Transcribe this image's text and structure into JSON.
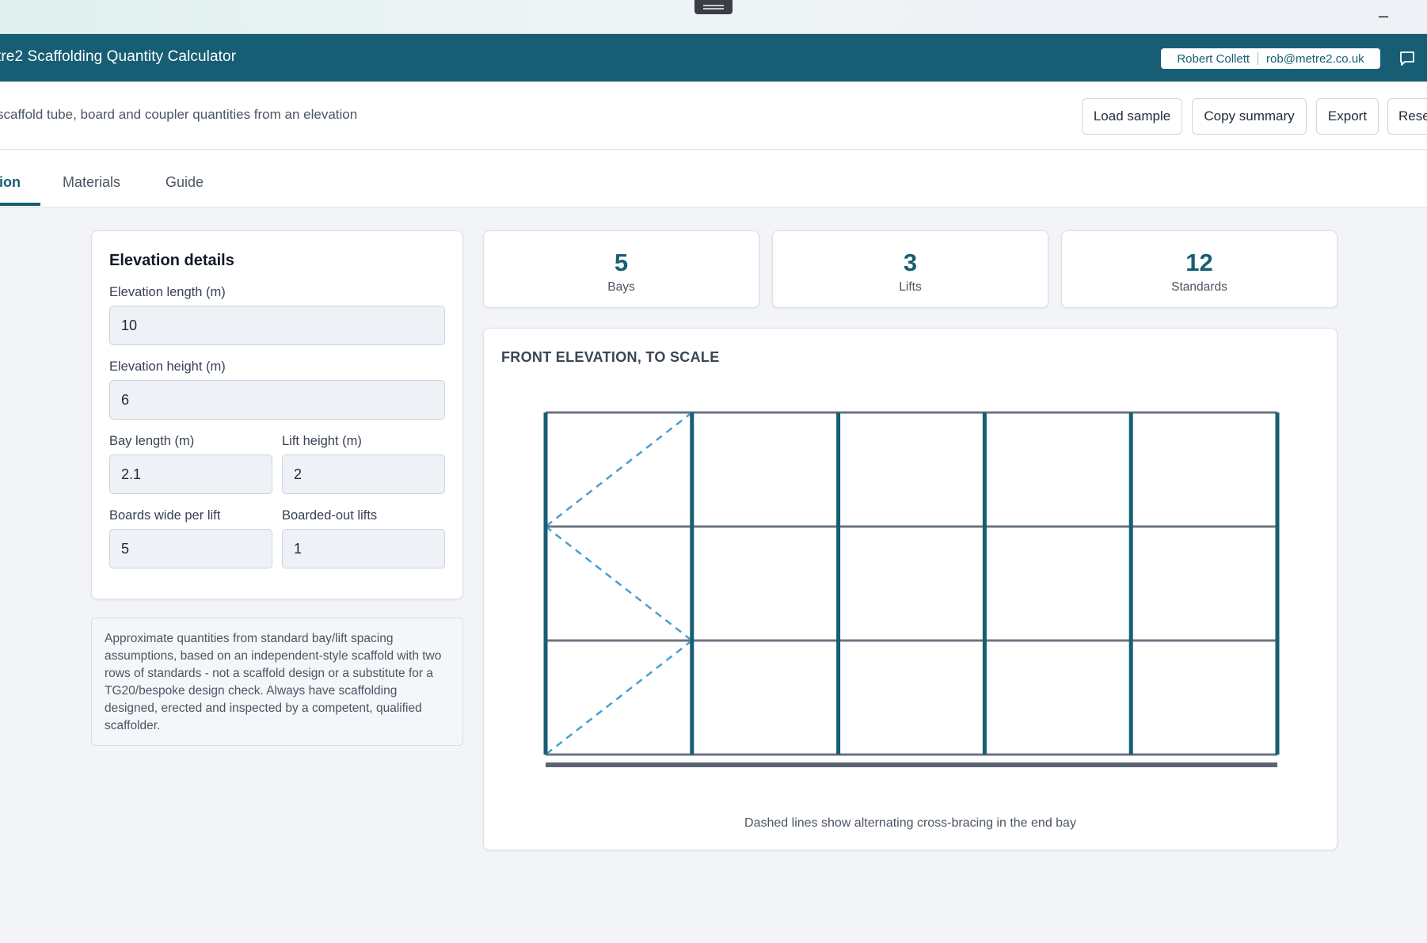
{
  "window": {
    "minimize_glyph": "–"
  },
  "header": {
    "title": "tre2 Scaffolding Quantity Calculator",
    "user_name": "Robert Collett",
    "user_email": "rob@metre2.co.uk"
  },
  "subheader": {
    "subtitle": "scaffold tube, board and coupler quantities from an elevation",
    "buttons": {
      "load_sample": "Load sample",
      "copy_summary": "Copy summary",
      "export": "Export",
      "reset": "Rese"
    }
  },
  "tabs": [
    {
      "label": "ion",
      "active": true
    },
    {
      "label": "Materials",
      "active": false
    },
    {
      "label": "Guide",
      "active": false
    }
  ],
  "form": {
    "title": "Elevation details",
    "elevation_length": {
      "label": "Elevation length (m)",
      "value": "10"
    },
    "elevation_height": {
      "label": "Elevation height (m)",
      "value": "6"
    },
    "bay_length": {
      "label": "Bay length (m)",
      "value": "2.1"
    },
    "lift_height": {
      "label": "Lift height (m)",
      "value": "2"
    },
    "boards_wide": {
      "label": "Boards wide per lift",
      "value": "5"
    },
    "boarded_lifts": {
      "label": "Boarded-out lifts",
      "value": "1"
    }
  },
  "note": "Approximate quantities from standard bay/lift spacing assumptions, based on an independent-style scaffold with two rows of standards - not a scaffold design or a substitute for a TG20/bespoke design check. Always have scaffolding designed, erected and inspected by a competent, qualified scaffolder.",
  "stats": [
    {
      "value": "5",
      "label": "Bays"
    },
    {
      "value": "3",
      "label": "Lifts"
    },
    {
      "value": "12",
      "label": "Standards"
    }
  ],
  "elevation": {
    "title": "FRONT ELEVATION, TO SCALE",
    "caption": "Dashed lines show alternating cross-bracing in the end bay",
    "bays": 5,
    "lifts": 3
  },
  "colors": {
    "brand": "#175e74",
    "standard": "#175e74",
    "ledger": "#6b7480",
    "brace": "#4a9fd0",
    "base": "#5a6472"
  }
}
